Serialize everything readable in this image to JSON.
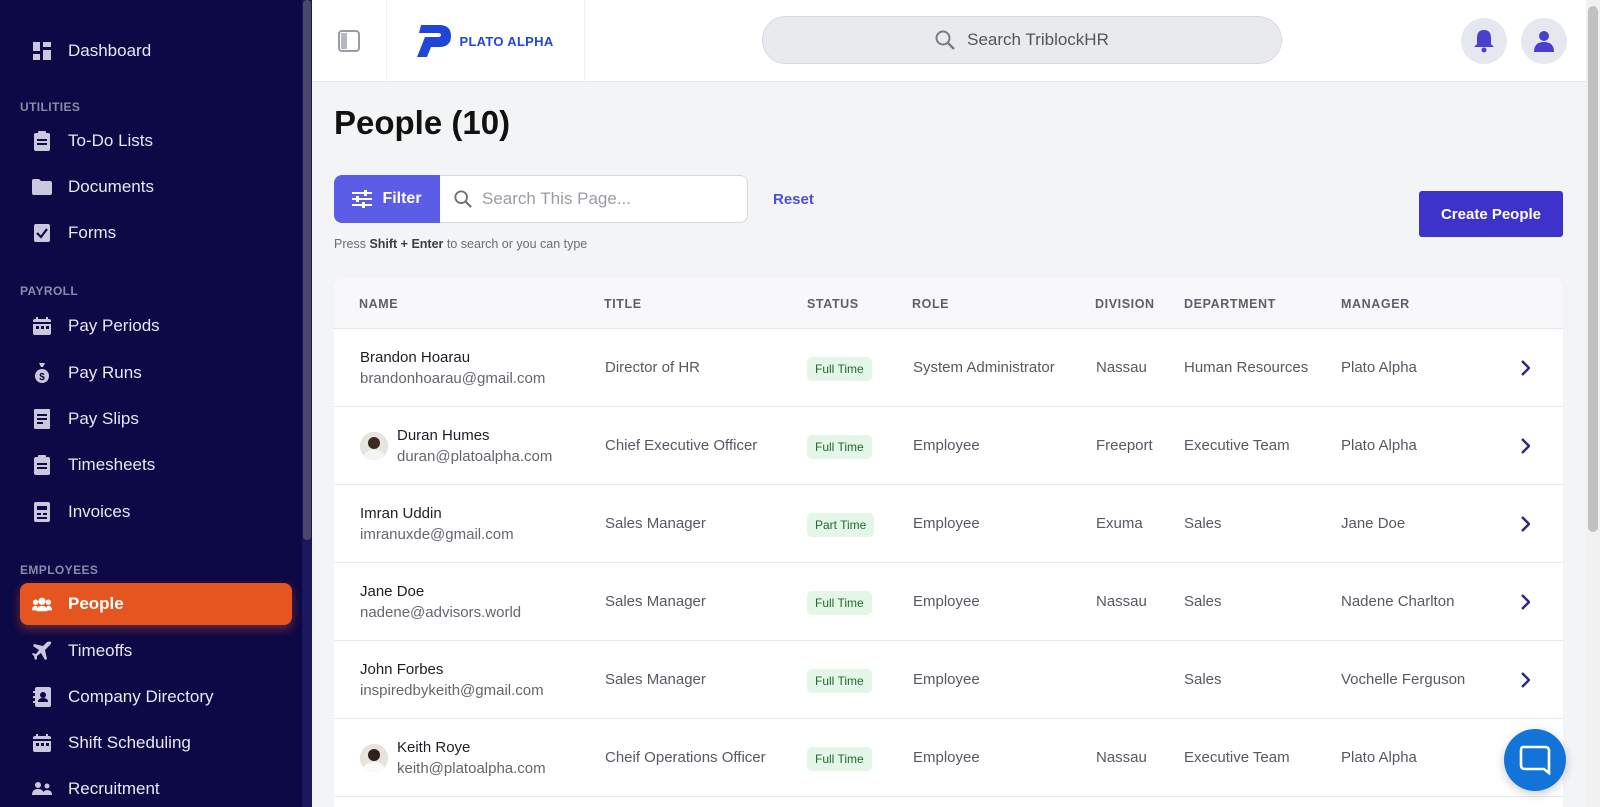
{
  "sidebar": {
    "dashboard": "Dashboard",
    "sections": {
      "utilities": "UTILITIES",
      "payroll": "PAYROLL",
      "employees": "EMPLOYEES"
    },
    "items": {
      "todo": "To-Do Lists",
      "documents": "Documents",
      "forms": "Forms",
      "pay_periods": "Pay Periods",
      "pay_runs": "Pay Runs",
      "pay_slips": "Pay Slips",
      "timesheets": "Timesheets",
      "invoices": "Invoices",
      "people": "People",
      "timeoffs": "Timeoffs",
      "company_directory": "Company Directory",
      "shift_scheduling": "Shift Scheduling",
      "recruitment": "Recruitment"
    }
  },
  "topbar": {
    "logo": "PLATO ALPHA",
    "search_placeholder": "Search TriblockHR"
  },
  "main": {
    "title": "People (10)",
    "filter_label": "Filter",
    "search_placeholder": "Search This Page...",
    "reset_label": "Reset",
    "hint": {
      "pre": "Press",
      "keys": "Shift + Enter",
      "post": "to search or you can type"
    },
    "create_label": "Create People"
  },
  "table": {
    "headers": [
      "NAME",
      "TITLE",
      "STATUS",
      "ROLE",
      "DIVISION",
      "DEPARTMENT",
      "MANAGER"
    ],
    "rows": [
      {
        "name": "Brandon Hoarau",
        "email": "brandonhoarau@gmail.com",
        "title": "Director of HR",
        "status": "Full Time",
        "role": "System Administrator",
        "division": "Nassau",
        "department": "Human Resources",
        "manager": "Plato Alpha"
      },
      {
        "name": "Duran Humes",
        "email": "duran@platoalpha.com",
        "title": "Chief Executive Officer",
        "status": "Full Time",
        "role": "Employee",
        "division": "Freeport",
        "department": "Executive Team",
        "manager": "Plato Alpha"
      },
      {
        "name": "Imran Uddin",
        "email": "imranuxde@gmail.com",
        "title": "Sales Manager",
        "status": "Part Time",
        "role": "Employee",
        "division": "Exuma",
        "department": "Sales",
        "manager": "Jane Doe"
      },
      {
        "name": "Jane Doe",
        "email": "nadene@advisors.world",
        "title": "Sales Manager",
        "status": "Full Time",
        "role": "Employee",
        "division": "Nassau",
        "department": "Sales",
        "manager": "Nadene Charlton"
      },
      {
        "name": "John Forbes",
        "email": "inspiredbykeith@gmail.com",
        "title": "Sales Manager",
        "status": "Full Time",
        "role": "Employee",
        "division": "",
        "department": "Sales",
        "manager": "Vochelle Ferguson"
      },
      {
        "name": "Keith Roye",
        "email": "keith@platoalpha.com",
        "title": "Cheif Operations Officer",
        "status": "Full Time",
        "role": "Employee",
        "division": "Nassau",
        "department": "Executive Team",
        "manager": "Plato Alpha"
      }
    ]
  },
  "colors": {
    "sidebar_bg": "#0d0846",
    "active": "#e4551f",
    "primary": "#3d32c9",
    "filter": "#5b5de6"
  },
  "icons": [
    "dashboard-icon",
    "clipboard-icon",
    "folder-icon",
    "form-check-icon",
    "calendar-icon",
    "money-bag-icon",
    "receipt-icon",
    "invoice-icon",
    "people-icon",
    "plane-icon",
    "contact-card-icon",
    "recruit-icon",
    "search-icon",
    "bell-icon",
    "user-icon",
    "sliders-icon",
    "chevron-right-icon",
    "chat-icon"
  ]
}
